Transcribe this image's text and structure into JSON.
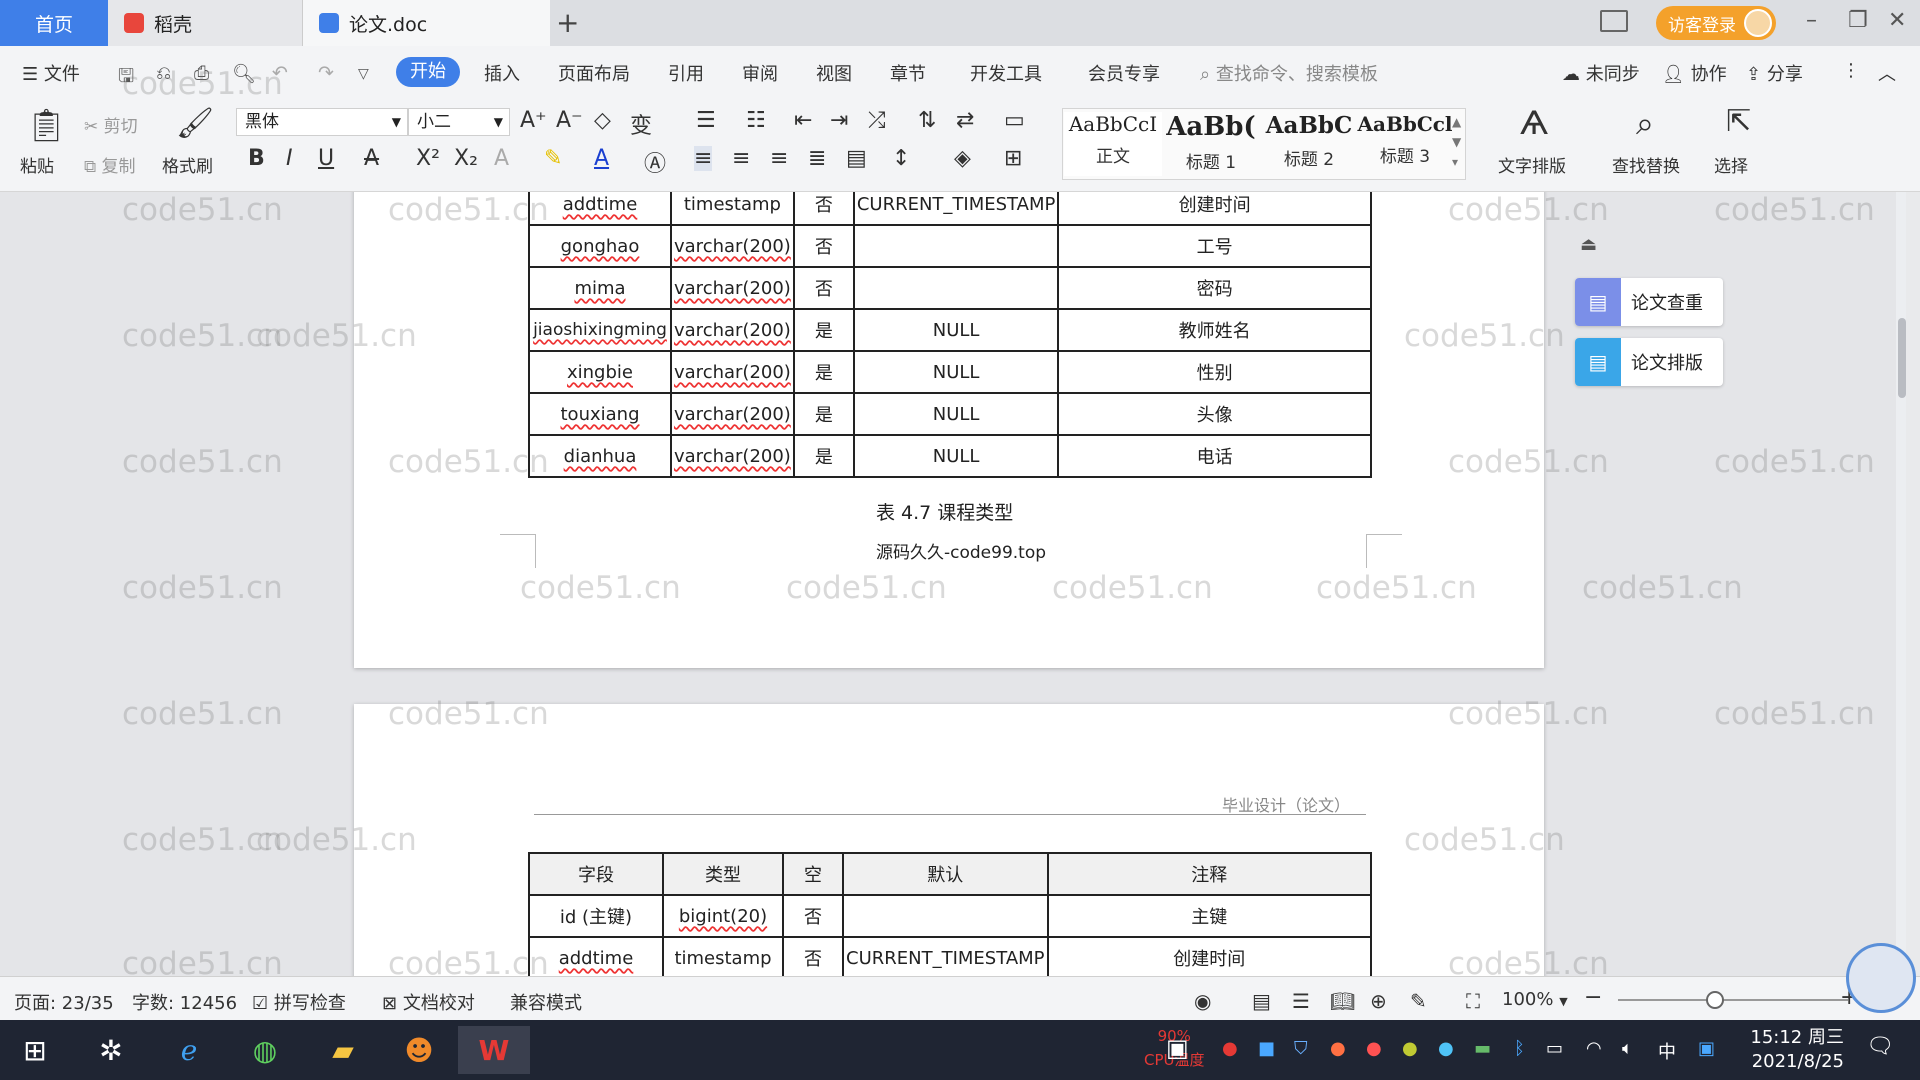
{
  "tabs": {
    "home": "首页",
    "docer": "稻壳",
    "doc": "论文.doc",
    "new_tab": "+"
  },
  "titlebar": {
    "login": "访客登录"
  },
  "menu": {
    "file": "文件",
    "start": "开始",
    "insert": "插入",
    "layout": "页面布局",
    "reference": "引用",
    "review": "审阅",
    "view": "视图",
    "chapter": "章节",
    "devtools": "开发工具",
    "member": "会员专享",
    "search_placeholder": "查找命令、搜索模板",
    "unsynced": "未同步",
    "collab": "协作",
    "share": "分享"
  },
  "ribbon": {
    "paste": "粘贴",
    "cut": "剪切",
    "copy": "复制",
    "format_painter": "格式刷",
    "font_name": "黑体",
    "font_size": "小二",
    "styles": [
      {
        "sample": "AaBbCcI",
        "label": "正文"
      },
      {
        "sample": "AaBb(",
        "label": "标题 1"
      },
      {
        "sample": "AaBbC",
        "label": "标题 2"
      },
      {
        "sample": "AaBbCcl",
        "label": "标题 3"
      }
    ],
    "text_layout": "文字排版",
    "find_replace": "查找替换",
    "select": "选择"
  },
  "table1": {
    "rows": [
      [
        "addtime",
        "timestamp",
        "否",
        "CURRENT_TIMESTAMP",
        "创建时间"
      ],
      [
        "gonghao",
        "varchar(200)",
        "否",
        "",
        "工号"
      ],
      [
        "mima",
        "varchar(200)",
        "否",
        "",
        "密码"
      ],
      [
        "jiaoshixingming",
        "varchar(200)",
        "是",
        "NULL",
        "教师姓名"
      ],
      [
        "xingbie",
        "varchar(200)",
        "是",
        "NULL",
        "性别"
      ],
      [
        "touxiang",
        "varchar(200)",
        "是",
        "NULL",
        "头像"
      ],
      [
        "dianhua",
        "varchar(200)",
        "是",
        "NULL",
        "电话"
      ]
    ]
  },
  "caption": "表 4.7  课程类型",
  "source_note": "源码久久-code99.top",
  "page2": {
    "header": "毕业设计（论文）",
    "headers": [
      "字段",
      "类型",
      "空",
      "默认",
      "注释"
    ],
    "rows": [
      [
        "id (主键)",
        "bigint(20)",
        "否",
        "",
        "主键"
      ],
      [
        "addtime",
        "timestamp",
        "否",
        "CURRENT_TIMESTAMP",
        "创建时间"
      ]
    ]
  },
  "side_panel": {
    "check": "论文查重",
    "format": "论文排版"
  },
  "watermark": "code51.cn",
  "statusbar": {
    "page": "页面: 23/35",
    "words": "字数: 12456",
    "spell": "拼写检查",
    "proof": "文档校对",
    "compat": "兼容模式",
    "zoom": "100%"
  },
  "taskbar": {
    "cpu": "90%",
    "cpu_label": "CPU温度",
    "ime": "中",
    "time": "15:12 周三",
    "date": "2021/8/25"
  },
  "colors": {
    "accent": "#3f7fe8",
    "login": "#f4a12b"
  }
}
